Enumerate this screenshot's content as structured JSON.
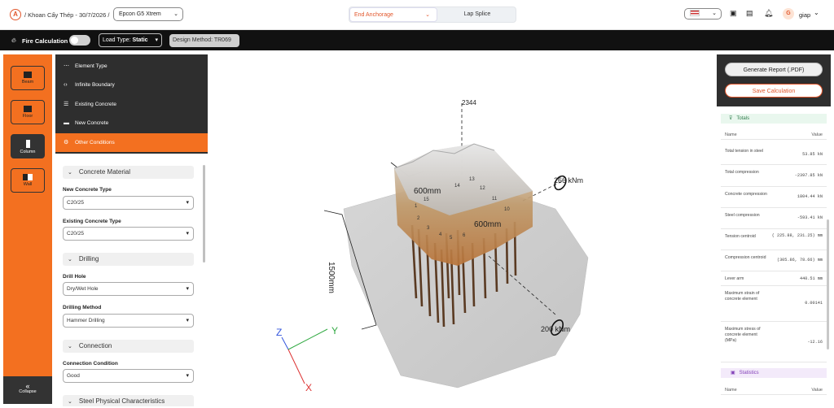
{
  "header": {
    "breadcrumb": "/ Khoan Cấy Thép - 30/7/2026 /",
    "product": "Epcon G5 Xtrem",
    "tabs": [
      {
        "label": "End Anchorage"
      },
      {
        "label": "Lap Splice"
      }
    ],
    "user": {
      "initial": "G",
      "name": "giap"
    }
  },
  "toolbar": {
    "fire_label": "Fire Calculation",
    "fire_enabled": false,
    "load_type_prefix": "Load Type:",
    "load_type_value": "Static",
    "design_method": "Design Method: TR069"
  },
  "leftbar": {
    "items": [
      {
        "label": "Beam"
      },
      {
        "label": "Floor"
      },
      {
        "label": "Column",
        "active": true
      },
      {
        "label": "Wall"
      }
    ],
    "collapse_label": "Collapse"
  },
  "menu": {
    "items": [
      {
        "label": "Element Type"
      },
      {
        "label": "Infinite Boundary"
      },
      {
        "label": "Existing Concrete"
      },
      {
        "label": "New Concrete"
      },
      {
        "label": "Other Conditions",
        "active": true
      }
    ]
  },
  "panel": {
    "concrete_material": "Concrete Material",
    "new_concrete_type_label": "New Concrete Type",
    "new_concrete_type": "C20/25",
    "existing_concrete_type_label": "Existing Concrete Type",
    "existing_concrete_type": "C20/25",
    "drilling": "Drilling",
    "drill_hole_label": "Drill Hole",
    "drill_hole": "Dry/Wet Hole",
    "drilling_method_label": "Drilling Method",
    "drilling_method": "Hammer Drilling",
    "connection": "Connection",
    "connection_condition_label": "Connection Condition",
    "connection_condition": "Good",
    "steel_physical": "Steel Physical Characteristics"
  },
  "viewport": {
    "dim_top": "2344",
    "dim_a": "600mm",
    "dim_b": "600mm",
    "dim_height": "1500mm",
    "moment_top": "266 kNm",
    "moment_bottom": "200 kNm",
    "axis_z": "Z",
    "axis_y": "Y",
    "axis_x": "X",
    "rebar_labels": [
      "15",
      "14",
      "13",
      "12",
      "11",
      "10",
      "1",
      "2",
      "3",
      "4",
      "5",
      "6"
    ]
  },
  "report": {
    "generate_label": "Generate Report (.PDF)",
    "save_label": "Save Calculation",
    "totals_label": "Totals",
    "name_header": "Name",
    "value_header": "Value",
    "rows": [
      {
        "name": "Total tension in steel",
        "value": "53.85 kN"
      },
      {
        "name": "Total compression",
        "value": "-2397.85 kN"
      },
      {
        "name": "Concrete compression",
        "value": "1804.44 kN"
      },
      {
        "name": "Steel compression",
        "value": "-593.41 kN"
      },
      {
        "name": "Tension centroid",
        "value": "( 225.88, 231.25) mm"
      },
      {
        "name": "Compression centroid",
        "value": "(305.86, 78.66) mm"
      },
      {
        "name": "Lever arm",
        "value": "440.51 mm"
      },
      {
        "name": "Maximum strain of concrete element",
        "value": "0.00141"
      },
      {
        "name": "Maximum stress of concrete element (MPa)",
        "value": "-12.16"
      }
    ],
    "statistics_label": "Statistics",
    "stats_name_header": "Name",
    "stats_value_header": "Value"
  }
}
